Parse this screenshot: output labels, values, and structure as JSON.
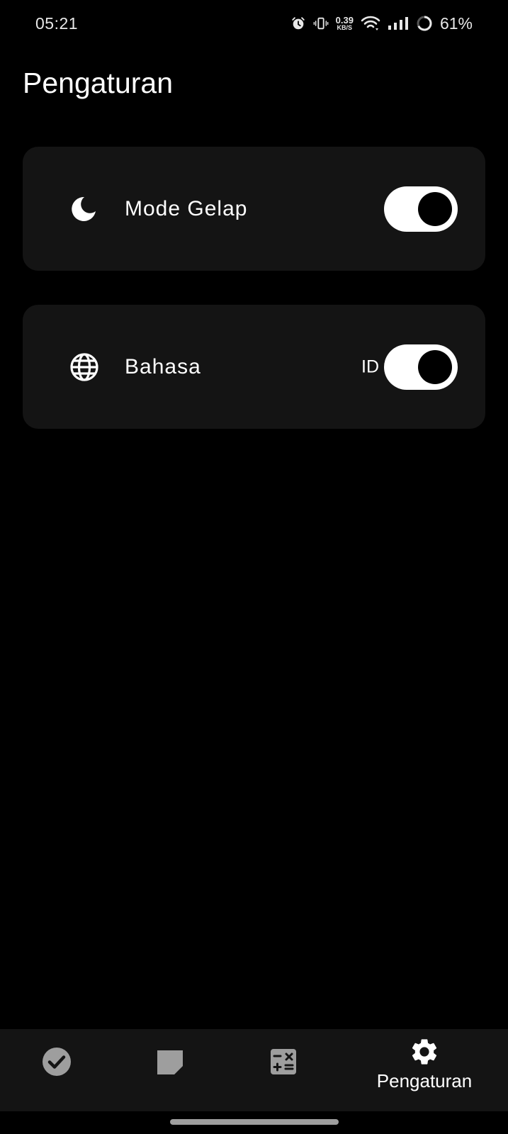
{
  "status_bar": {
    "time": "05:21",
    "net_speed_value": "0.39",
    "net_speed_unit": "KB/S",
    "battery": "61%",
    "icons": [
      "alarm-icon",
      "vibrate-icon",
      "wifi-icon",
      "signal-icon",
      "battery-ring-icon"
    ]
  },
  "page": {
    "title": "Pengaturan"
  },
  "settings": {
    "dark_mode": {
      "icon": "moon-icon",
      "label": "Mode Gelap",
      "enabled": true
    },
    "language": {
      "icon": "globe-icon",
      "label": "Bahasa",
      "value": "ID"
    }
  },
  "bottom_nav": {
    "items": [
      {
        "icon": "check-circle-icon"
      },
      {
        "icon": "note-icon"
      },
      {
        "icon": "calculator-icon"
      },
      {
        "icon": "gear-icon",
        "label": "Pengaturan",
        "active": true
      }
    ]
  },
  "colors": {
    "background": "#000000",
    "card": "#141414",
    "text": "#ffffff",
    "inactive_icon": "#9e9e9e"
  }
}
